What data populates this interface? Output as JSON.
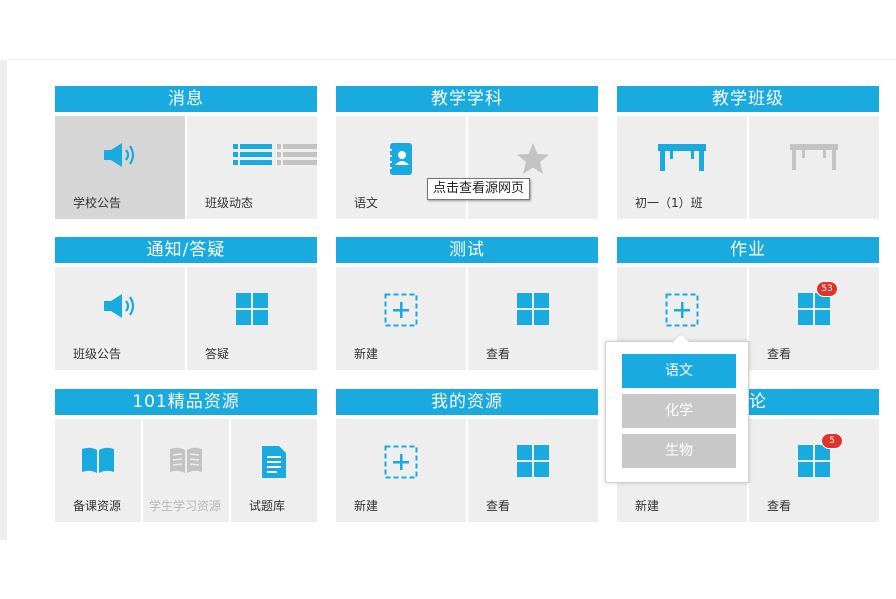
{
  "tooltip": "点击查看源网页",
  "panels": {
    "news": {
      "title": "消息",
      "tiles": [
        "学校公告",
        "班级动态"
      ]
    },
    "subjects": {
      "title": "教学学科",
      "tiles": [
        "语文",
        ""
      ]
    },
    "classes": {
      "title": "教学班级",
      "tiles": [
        "初一（1）班",
        ""
      ]
    },
    "notice": {
      "title": "通知/答疑",
      "tiles": [
        "班级公告",
        "答疑"
      ]
    },
    "test": {
      "title": "测试",
      "tiles": [
        "新建",
        "查看"
      ]
    },
    "homework": {
      "title": "作业",
      "tiles": [
        "",
        "查看"
      ],
      "badge": "53"
    },
    "res101": {
      "title": "101精品资源",
      "tiles": [
        "备课资源",
        "学生学习资源",
        "试题库"
      ]
    },
    "myres": {
      "title": "我的资源",
      "tiles": [
        "新建",
        "查看"
      ]
    },
    "discuss": {
      "title": "论",
      "tiles": [
        "新建",
        "查看"
      ],
      "badge": "5"
    }
  },
  "popup": {
    "options": [
      "语文",
      "化学",
      "生物"
    ],
    "selected": "语文"
  },
  "colors": {
    "accent": "#19aadf",
    "tile": "#eeeeee",
    "icon_disabled": "#c3c3c3"
  }
}
